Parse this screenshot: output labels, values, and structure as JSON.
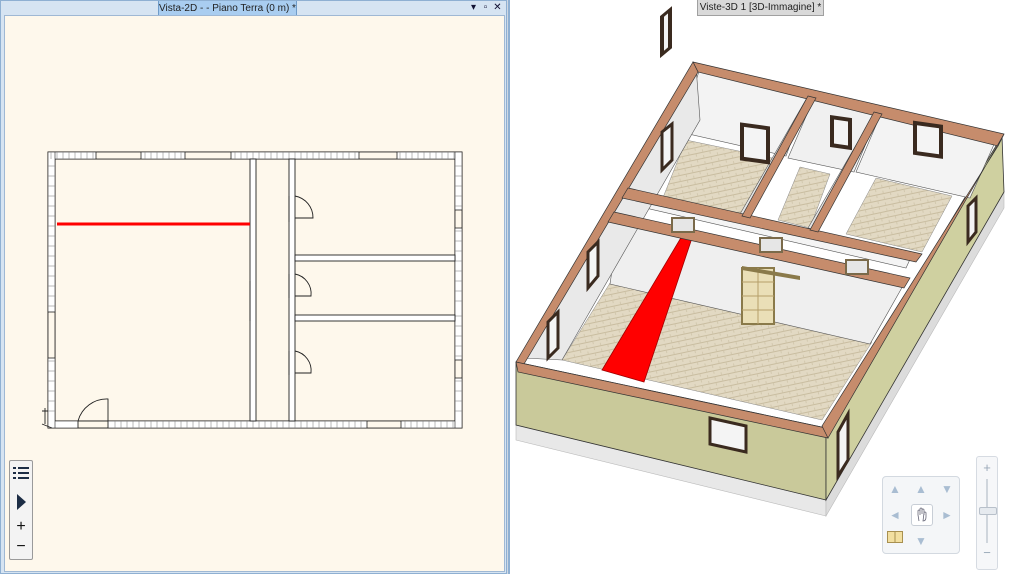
{
  "left_pane": {
    "tab_title": "Vista-2D -  - Piano Terra (0 m) *",
    "window_buttons": [
      "▾",
      "▫",
      "✕"
    ]
  },
  "right_pane": {
    "tab_title": "Viste-3D 1 [3D-Immagine] *"
  },
  "toolbar2d": {
    "list_icon": "list-icon",
    "play_icon": "play-icon",
    "zoom_in": "+",
    "zoom_out": "−"
  },
  "nav3d": {
    "up": "▲",
    "down": "▼",
    "left": "◄",
    "right": "►",
    "pan_icon": "hand-icon",
    "zoom_plus": "+",
    "zoom_minus": "−"
  },
  "colors": {
    "accent_wall": "#ff0000",
    "exterior_wall": "#c9c99a",
    "wall_top": "#c68c6c",
    "floor": "#dcd2bb",
    "plan_background": "#fef8ec"
  }
}
